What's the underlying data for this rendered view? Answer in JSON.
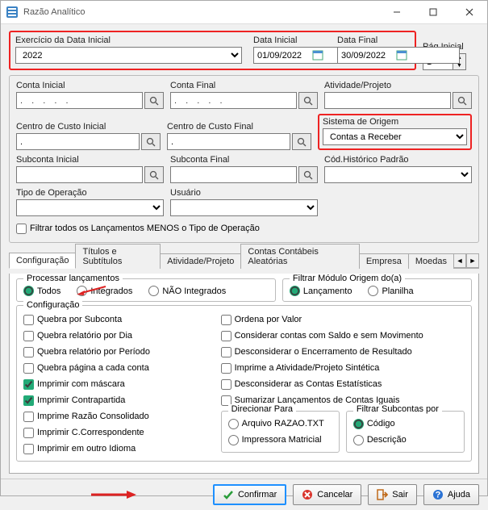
{
  "window": {
    "title": "Razão Analítico"
  },
  "top": {
    "exercicio_label": "Exercício da Data Inicial",
    "exercicio_value": "2022",
    "data_inicial_label": "Data Inicial",
    "data_inicial_value": "01/09/2022",
    "data_final_label": "Data Final",
    "data_final_value": "30/09/2022",
    "pag_inicial_label": "Pág.Inicial",
    "pag_inicial_value": "1"
  },
  "filters": {
    "conta_inicial_label": "Conta Inicial",
    "conta_inicial_value": ". . . . .",
    "conta_final_label": "Conta Final",
    "conta_final_value": ". . . . .",
    "atividade_label": "Atividade/Projeto",
    "atividade_value": "",
    "centro_inicial_label": "Centro de Custo Inicial",
    "centro_inicial_value": ".",
    "centro_final_label": "Centro de Custo Final",
    "centro_final_value": ".",
    "sistema_origem_label": "Sistema de Origem",
    "sistema_origem_value": "Contas a Receber",
    "subconta_inicial_label": "Subconta Inicial",
    "subconta_final_label": "Subconta Final",
    "cod_hist_label": "Cód.Histórico Padrão",
    "tipo_operacao_label": "Tipo de Operação",
    "usuario_label": "Usuário",
    "filtrar_menos_label": "Filtrar todos os Lançamentos MENOS o Tipo de Operação"
  },
  "tabs": {
    "t0": "Configuração",
    "t1": "Títulos e Subtítulos",
    "t2": "Atividade/Projeto",
    "t3": "Contas Contábeis Aleatórias",
    "t4": "Empresa",
    "t5": "Moedas"
  },
  "proc": {
    "legend": "Processar lançamentos",
    "todos": "Todos",
    "integrados": "Integrados",
    "nao_integrados": "NÃO Integrados"
  },
  "filtMod": {
    "legend": "Filtrar Módulo Origem do(a)",
    "lancamento": "Lançamento",
    "planilha": "Planilha"
  },
  "config": {
    "legend": "Configuração",
    "left": {
      "c0": "Quebra por Subconta",
      "c1": "Quebra relatório por Dia",
      "c2": "Quebra relatório por Período",
      "c3": "Quebra página a cada conta",
      "c4": "Imprimir com máscara",
      "c5": "Imprimir Contrapartida",
      "c6": "Imprime Razão Consolidado",
      "c7": "Imprimir C.Correspondente",
      "c8": "Imprimir em outro Idioma"
    },
    "right": {
      "c0": "Ordena por Valor",
      "c1": "Considerar contas com Saldo e sem Movimento",
      "c2": "Desconsiderar o Encerramento de Resultado",
      "c3": "Imprime a Atividade/Projeto Sintética",
      "c4": "Desconsiderar as Contas Estatísticas",
      "c5": "Sumarizar Lançamentos de Contas Iguais"
    },
    "direcionar": {
      "legend": "Direcionar  Para",
      "r0": "Arquivo RAZAO.TXT",
      "r1": "Impressora Matricial"
    },
    "filtsub": {
      "legend": "Filtrar Subcontas por",
      "r0": "Código",
      "r1": "Descrição"
    }
  },
  "buttons": {
    "confirmar": "Confirmar",
    "cancelar": "Cancelar",
    "sair": "Sair",
    "ajuda": "Ajuda"
  }
}
